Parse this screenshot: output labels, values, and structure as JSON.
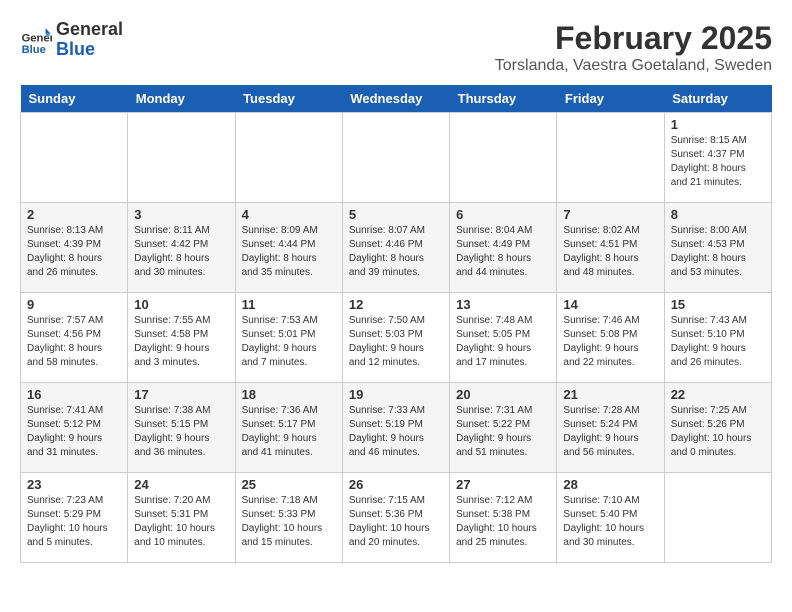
{
  "logo": {
    "text_general": "General",
    "text_blue": "Blue"
  },
  "title": "February 2025",
  "subtitle": "Torslanda, Vaestra Goetaland, Sweden",
  "days_of_week": [
    "Sunday",
    "Monday",
    "Tuesday",
    "Wednesday",
    "Thursday",
    "Friday",
    "Saturday"
  ],
  "weeks": [
    [
      {
        "day": "",
        "info": ""
      },
      {
        "day": "",
        "info": ""
      },
      {
        "day": "",
        "info": ""
      },
      {
        "day": "",
        "info": ""
      },
      {
        "day": "",
        "info": ""
      },
      {
        "day": "",
        "info": ""
      },
      {
        "day": "1",
        "info": "Sunrise: 8:15 AM\nSunset: 4:37 PM\nDaylight: 8 hours and 21 minutes."
      }
    ],
    [
      {
        "day": "2",
        "info": "Sunrise: 8:13 AM\nSunset: 4:39 PM\nDaylight: 8 hours and 26 minutes."
      },
      {
        "day": "3",
        "info": "Sunrise: 8:11 AM\nSunset: 4:42 PM\nDaylight: 8 hours and 30 minutes."
      },
      {
        "day": "4",
        "info": "Sunrise: 8:09 AM\nSunset: 4:44 PM\nDaylight: 8 hours and 35 minutes."
      },
      {
        "day": "5",
        "info": "Sunrise: 8:07 AM\nSunset: 4:46 PM\nDaylight: 8 hours and 39 minutes."
      },
      {
        "day": "6",
        "info": "Sunrise: 8:04 AM\nSunset: 4:49 PM\nDaylight: 8 hours and 44 minutes."
      },
      {
        "day": "7",
        "info": "Sunrise: 8:02 AM\nSunset: 4:51 PM\nDaylight: 8 hours and 48 minutes."
      },
      {
        "day": "8",
        "info": "Sunrise: 8:00 AM\nSunset: 4:53 PM\nDaylight: 8 hours and 53 minutes."
      }
    ],
    [
      {
        "day": "9",
        "info": "Sunrise: 7:57 AM\nSunset: 4:56 PM\nDaylight: 8 hours and 58 minutes."
      },
      {
        "day": "10",
        "info": "Sunrise: 7:55 AM\nSunset: 4:58 PM\nDaylight: 9 hours and 3 minutes."
      },
      {
        "day": "11",
        "info": "Sunrise: 7:53 AM\nSunset: 5:01 PM\nDaylight: 9 hours and 7 minutes."
      },
      {
        "day": "12",
        "info": "Sunrise: 7:50 AM\nSunset: 5:03 PM\nDaylight: 9 hours and 12 minutes."
      },
      {
        "day": "13",
        "info": "Sunrise: 7:48 AM\nSunset: 5:05 PM\nDaylight: 9 hours and 17 minutes."
      },
      {
        "day": "14",
        "info": "Sunrise: 7:46 AM\nSunset: 5:08 PM\nDaylight: 9 hours and 22 minutes."
      },
      {
        "day": "15",
        "info": "Sunrise: 7:43 AM\nSunset: 5:10 PM\nDaylight: 9 hours and 26 minutes."
      }
    ],
    [
      {
        "day": "16",
        "info": "Sunrise: 7:41 AM\nSunset: 5:12 PM\nDaylight: 9 hours and 31 minutes."
      },
      {
        "day": "17",
        "info": "Sunrise: 7:38 AM\nSunset: 5:15 PM\nDaylight: 9 hours and 36 minutes."
      },
      {
        "day": "18",
        "info": "Sunrise: 7:36 AM\nSunset: 5:17 PM\nDaylight: 9 hours and 41 minutes."
      },
      {
        "day": "19",
        "info": "Sunrise: 7:33 AM\nSunset: 5:19 PM\nDaylight: 9 hours and 46 minutes."
      },
      {
        "day": "20",
        "info": "Sunrise: 7:31 AM\nSunset: 5:22 PM\nDaylight: 9 hours and 51 minutes."
      },
      {
        "day": "21",
        "info": "Sunrise: 7:28 AM\nSunset: 5:24 PM\nDaylight: 9 hours and 56 minutes."
      },
      {
        "day": "22",
        "info": "Sunrise: 7:25 AM\nSunset: 5:26 PM\nDaylight: 10 hours and 0 minutes."
      }
    ],
    [
      {
        "day": "23",
        "info": "Sunrise: 7:23 AM\nSunset: 5:29 PM\nDaylight: 10 hours and 5 minutes."
      },
      {
        "day": "24",
        "info": "Sunrise: 7:20 AM\nSunset: 5:31 PM\nDaylight: 10 hours and 10 minutes."
      },
      {
        "day": "25",
        "info": "Sunrise: 7:18 AM\nSunset: 5:33 PM\nDaylight: 10 hours and 15 minutes."
      },
      {
        "day": "26",
        "info": "Sunrise: 7:15 AM\nSunset: 5:36 PM\nDaylight: 10 hours and 20 minutes."
      },
      {
        "day": "27",
        "info": "Sunrise: 7:12 AM\nSunset: 5:38 PM\nDaylight: 10 hours and 25 minutes."
      },
      {
        "day": "28",
        "info": "Sunrise: 7:10 AM\nSunset: 5:40 PM\nDaylight: 10 hours and 30 minutes."
      },
      {
        "day": "",
        "info": ""
      }
    ]
  ]
}
